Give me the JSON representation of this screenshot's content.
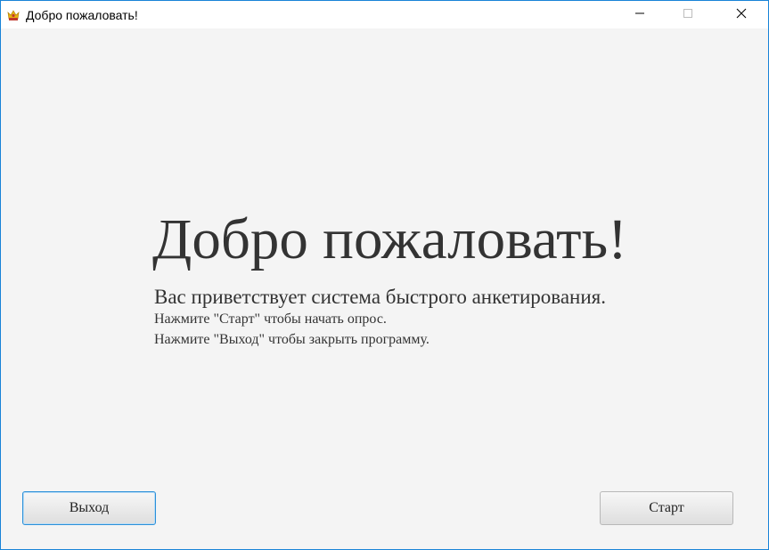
{
  "window": {
    "title": "Добро пожаловать!",
    "app_icon": "crown-icon",
    "controls": [
      "minimize-icon",
      "maximize-icon",
      "close-icon"
    ],
    "border_color": "#1883d7"
  },
  "content": {
    "headline": "Добро пожаловать!",
    "subtitle": "Вас приветствует система быстрого анкетирования.",
    "line_start": "Нажмите \"Старт\" чтобы начать опрос.",
    "line_exit": "Нажмите \"Выход\" чтобы закрыть программу."
  },
  "buttons": {
    "exit_label": "Выход",
    "start_label": "Старт"
  }
}
